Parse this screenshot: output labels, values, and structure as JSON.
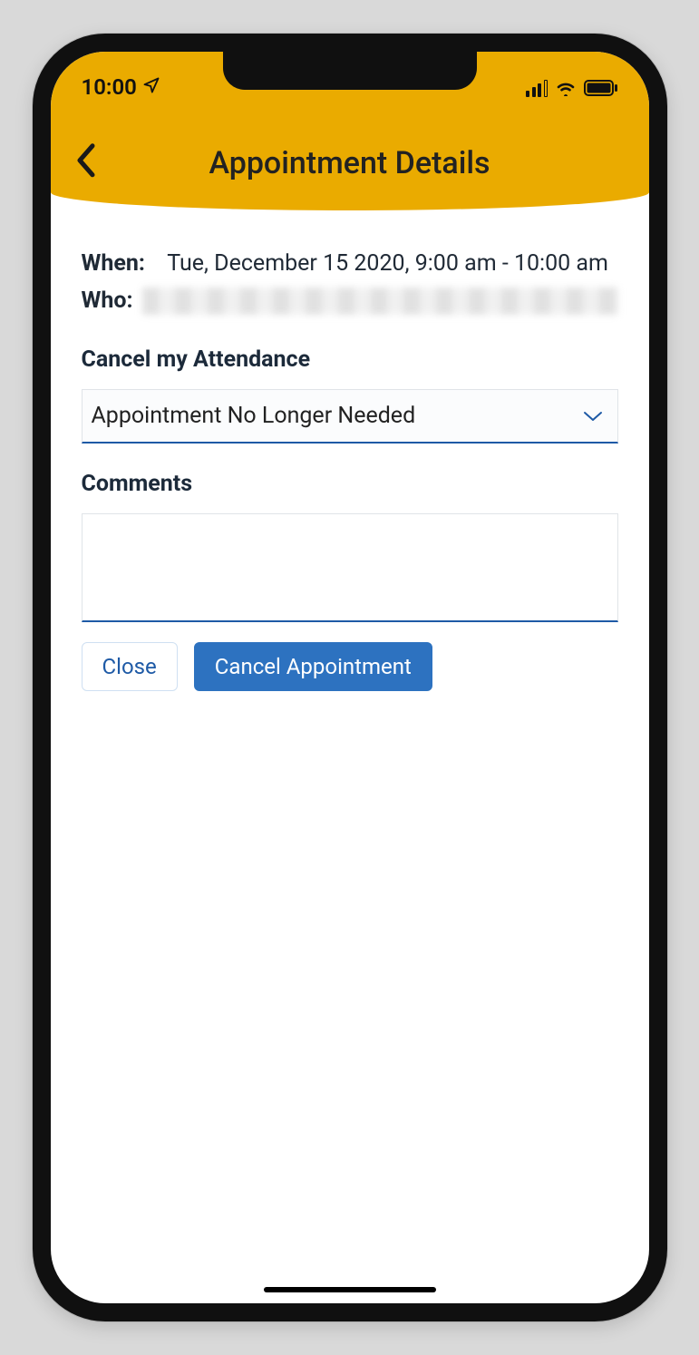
{
  "statusbar": {
    "time": "10:00"
  },
  "navbar": {
    "title": "Appointment Details"
  },
  "details": {
    "when_label": "When:",
    "when_value": "Tue, December 15 2020, 9:00 am - 10:00 am",
    "who_label": "Who:"
  },
  "cancel_section": {
    "title": "Cancel my Attendance",
    "reason_selected": "Appointment No Longer Needed"
  },
  "comments_section": {
    "title": "Comments",
    "value": ""
  },
  "buttons": {
    "close": "Close",
    "cancel_appointment": "Cancel Appointment"
  }
}
